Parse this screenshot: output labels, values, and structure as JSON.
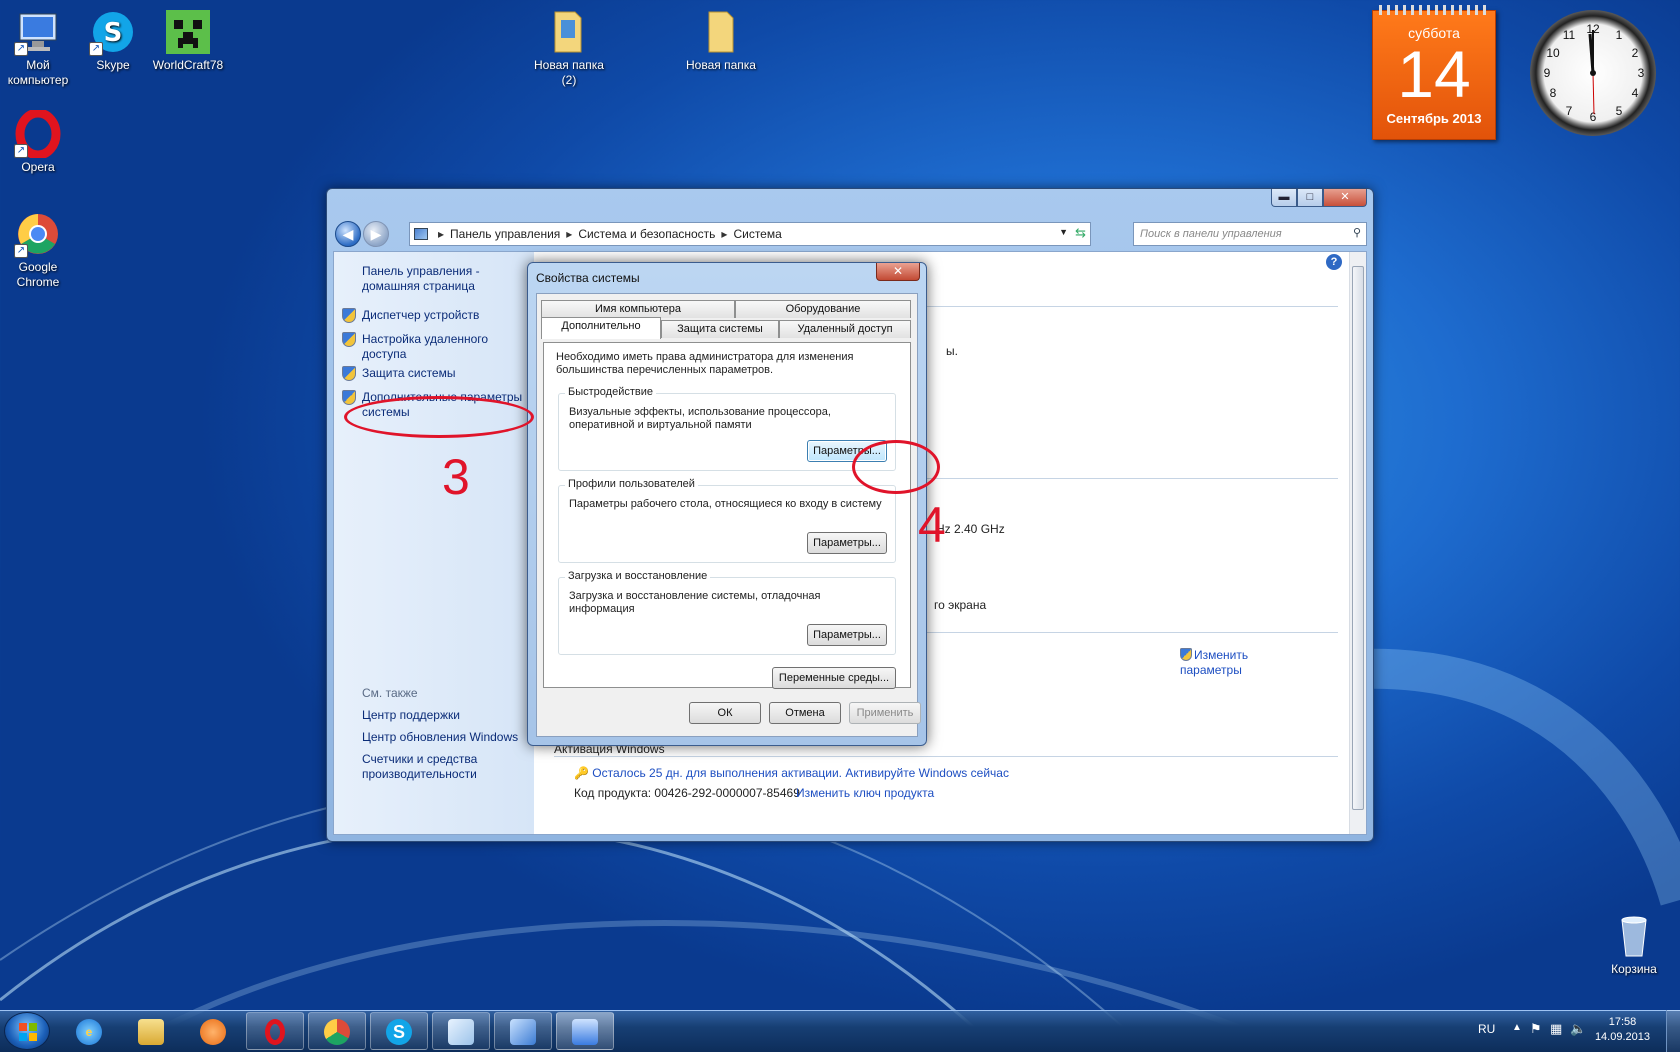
{
  "desktop": {
    "icons": [
      {
        "label": "Мой компьютер"
      },
      {
        "label": "Skype"
      },
      {
        "label": "WorldCraft78"
      },
      {
        "label": "Новая папка (2)"
      },
      {
        "label": "Новая папка"
      },
      {
        "label": "Opera"
      },
      {
        "label": "Google Chrome"
      },
      {
        "label": "Корзина"
      }
    ]
  },
  "calendar_gadget": {
    "weekday": "суббота",
    "day": "14",
    "month_year": "Сентябрь 2013"
  },
  "clock_gadget": {
    "numbers": [
      "12",
      "1",
      "2",
      "3",
      "4",
      "5",
      "6",
      "7",
      "8",
      "9",
      "10",
      "11"
    ]
  },
  "explorer": {
    "caption_buttons": {
      "minimize": "▬",
      "maximize": "□",
      "close": "✕"
    },
    "breadcrumb": [
      "Панель управления",
      "Система и безопасность",
      "Система"
    ],
    "search_placeholder": "Поиск в панели управления",
    "left_pane": {
      "home": "Панель управления - домашняя страница",
      "links": [
        "Диспетчер устройств",
        "Настройка удаленного доступа",
        "Защита системы",
        "Дополнительные параметры системы"
      ],
      "see_also_header": "См. также",
      "see_also": [
        "Центр поддержки",
        "Центр обновления Windows",
        "Счетчики и средства производительности"
      ]
    },
    "right_pane": {
      "partial_1": "ы.",
      "cpu_speed": "Hz  2.40 GHz",
      "partial_screen": "го экрана",
      "change_params": "Изменить параметры",
      "activation_header": "Активация Windows",
      "activation_link": "Осталось 25 дн. для выполнения активации. Активируйте Windows сейчас",
      "product_key": "Код продукта: 00426-292-0000007-85469",
      "change_key": "Изменить ключ продукта"
    }
  },
  "dialog": {
    "title": "Свойства системы",
    "close": "✕",
    "tabs_row1": [
      "Имя компьютера",
      "Оборудование"
    ],
    "tabs_row2": [
      "Дополнительно",
      "Защита системы",
      "Удаленный доступ"
    ],
    "admin_note": "Необходимо иметь права администратора для изменения большинства перечисленных параметров.",
    "groups": [
      {
        "title": "Быстродействие",
        "text": "Визуальные эффекты, использование процессора, оперативной и виртуальной памяти",
        "button": "Параметры..."
      },
      {
        "title": "Профили пользователей",
        "text": "Параметры рабочего стола, относящиеся ко входу в систему",
        "button": "Параметры..."
      },
      {
        "title": "Загрузка и восстановление",
        "text": "Загрузка и восстановление системы, отладочная информация",
        "button": "Параметры..."
      }
    ],
    "env_button": "Переменные среды...",
    "ok": "ОК",
    "cancel": "Отмена",
    "apply": "Применить"
  },
  "annotations": {
    "step3": "3",
    "step4": "4"
  },
  "taskbar": {
    "lang": "RU",
    "time": "17:58",
    "date": "14.09.2013"
  }
}
